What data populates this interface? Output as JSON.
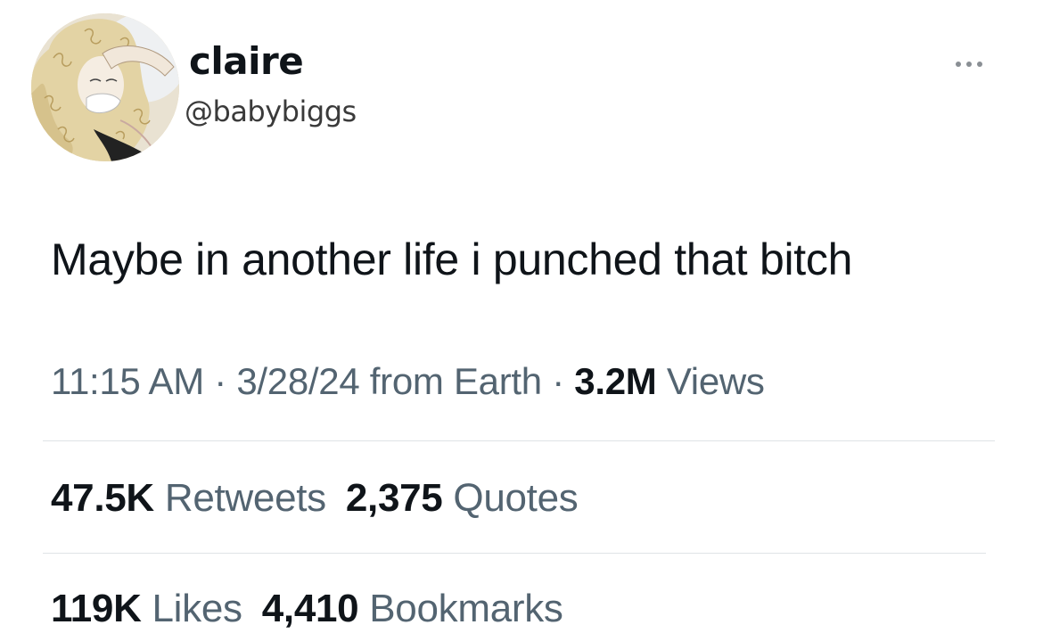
{
  "user": {
    "display_name": "claire",
    "handle": "@babybiggs",
    "avatar": "avatar-illustration"
  },
  "more_icon": "more-horizontal-icon",
  "tweet": {
    "text": "Maybe in another life i punched that bitch"
  },
  "meta": {
    "time": "11:15 AM",
    "sep1": " · ",
    "date": "3/28/24",
    "source": " from Earth",
    "sep2": " · ",
    "views_count": "3.2M",
    "views_label": " Views"
  },
  "stats_row1": {
    "retweets_count": "47.5K",
    "retweets_label": " Retweets",
    "quotes_count": "2,375",
    "quotes_label": " Quotes"
  },
  "stats_row2": {
    "likes_count": "119K",
    "likes_label": " Likes",
    "bookmarks_count": "4,410",
    "bookmarks_label": " Bookmarks"
  },
  "colors": {
    "text_primary": "#0f1419",
    "text_secondary": "#536471",
    "divider": "#dfe3e6"
  }
}
